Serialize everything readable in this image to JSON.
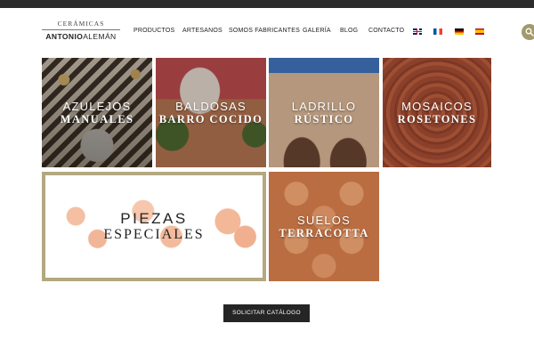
{
  "logo": {
    "line1": "CERÁMICAS",
    "line2_bold": "ANTONIO",
    "line2_regular": "ALEMÁN"
  },
  "nav": {
    "items": [
      {
        "label": "PRODUCTOS"
      },
      {
        "label": "ARTESANOS"
      },
      {
        "label": "SOMOS FABRICANTES"
      },
      {
        "label": "GALERÍA"
      },
      {
        "label": "BLOG"
      },
      {
        "label": "CONTACTO"
      }
    ]
  },
  "languages": [
    {
      "icon": "flag-uk-icon"
    },
    {
      "icon": "flag-france-icon"
    },
    {
      "icon": "flag-germany-icon"
    },
    {
      "icon": "flag-spain-icon"
    }
  ],
  "search": {
    "icon": "search-icon",
    "color": "#a39a6c"
  },
  "tiles": [
    {
      "line1": "AZULEJOS",
      "line2": "MANUALES"
    },
    {
      "line1": "BALDOSAS",
      "line2": "BARRO COCIDO"
    },
    {
      "line1": "LADRILLO",
      "line2": "RÚSTICO"
    },
    {
      "line1": "MOSAICOS",
      "line2": "ROSETONES"
    },
    {
      "line1": "PIEZAS",
      "line2": "ESPECIALES"
    },
    {
      "line1": "SUELOS",
      "line2": "TERRACOTTA"
    }
  ],
  "cta": {
    "label": "SOLICITAR CATÁLOGO"
  },
  "colors": {
    "topbar": "#2b2b2b",
    "accent": "#a39a6c",
    "button": "#252525",
    "frame": "#b3a881"
  }
}
